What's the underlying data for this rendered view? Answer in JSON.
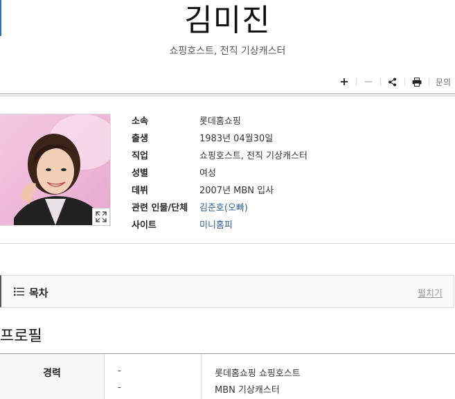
{
  "header": {
    "title": "김미진",
    "subtitle": "쇼핑호스트, 전직 기상캐스터"
  },
  "toolbar": {
    "zoom_in_icon": "plus-icon",
    "zoom_out_icon": "minus-icon",
    "share_icon": "share-icon",
    "print_icon": "print-icon",
    "inquiry_label": "문의"
  },
  "profile": {
    "rows": [
      {
        "label": "소속",
        "value": "롯데홈쇼핑"
      },
      {
        "label": "출생",
        "value": "1983년 04월30일"
      },
      {
        "label": "직업",
        "value": "쇼핑호스트, 전직 기상캐스터"
      },
      {
        "label": "성별",
        "value": "여성"
      },
      {
        "label": "데뷔",
        "value": "2007년 MBN 입사"
      },
      {
        "label": "관련 인물/단체",
        "value": "김준호(오빠)"
      },
      {
        "label": "사이트",
        "value": "미니홈피"
      }
    ]
  },
  "toc": {
    "title": "목차",
    "toggle_label": "펼치기"
  },
  "section": {
    "title": "프로필"
  },
  "career_table": {
    "header": "경력",
    "rows": [
      {
        "period": "-",
        "detail": "롯데홈쇼핑 쇼핑호스트"
      },
      {
        "period": "-",
        "detail": "MBN 기상캐스터"
      }
    ]
  },
  "colors": {
    "link": "#2a5d95",
    "accent": "#3b6ea8"
  }
}
